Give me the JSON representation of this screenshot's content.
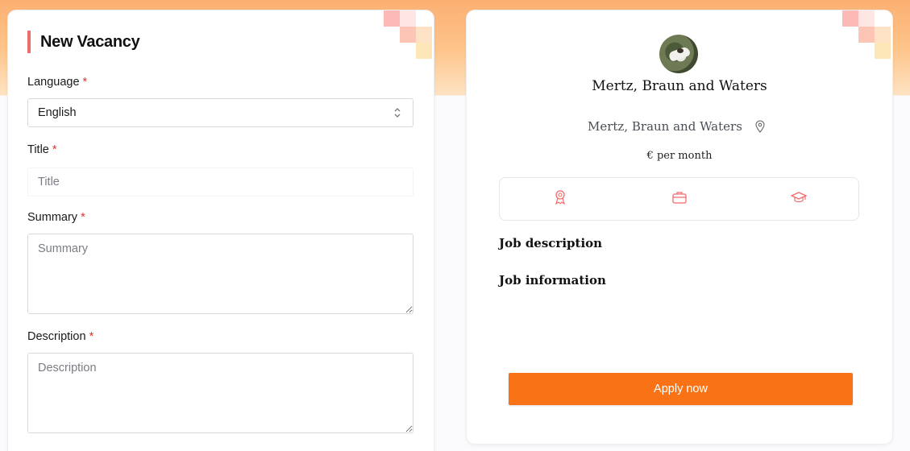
{
  "colors": {
    "accent": "#f97316",
    "required": "#e0342f",
    "header_bar": "#f26b6b",
    "icon": "#f26b6b"
  },
  "form": {
    "header": "New Vacancy",
    "language": {
      "label": "Language",
      "required_mark": "*",
      "value": "English",
      "icon": "chevron-up-down-icon"
    },
    "title": {
      "label": "Title",
      "required_mark": "*",
      "placeholder": "Title"
    },
    "summary": {
      "label": "Summary",
      "required_mark": "*",
      "placeholder": "Summary"
    },
    "description": {
      "label": "Description",
      "required_mark": "*",
      "placeholder": "Description"
    }
  },
  "preview": {
    "company_name": "Mertz, Braun and Waters",
    "company_subtitle": "Mertz, Braun and Waters",
    "location_icon": "map-pin-icon",
    "salary": "€ per month",
    "icons": [
      "award-icon",
      "briefcase-icon",
      "graduation-cap-icon"
    ],
    "job_description_heading": "Job description",
    "job_information_heading": "Job information",
    "apply_label": "Apply now"
  }
}
